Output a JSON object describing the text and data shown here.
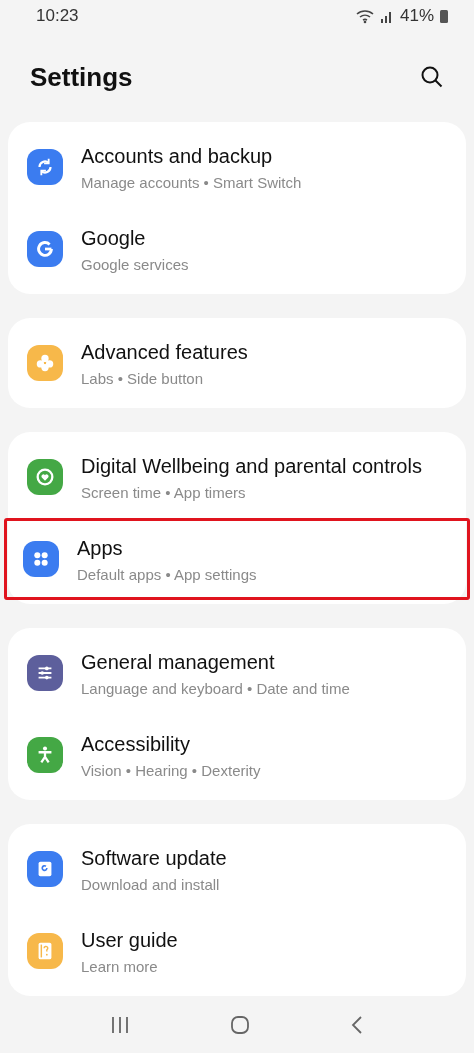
{
  "status_bar": {
    "time": "10:23",
    "battery": "41%"
  },
  "header": {
    "title": "Settings"
  },
  "groups": [
    {
      "items": [
        {
          "kind": "sync",
          "color": "#3b7cf0",
          "title": "Accounts and backup",
          "subtitle": "Manage accounts • Smart Switch",
          "highlighted": false
        },
        {
          "kind": "google",
          "color": "#3b7cf0",
          "title": "Google",
          "subtitle": "Google services",
          "highlighted": false
        }
      ]
    },
    {
      "items": [
        {
          "kind": "flower",
          "color": "#f7b84a",
          "title": "Advanced features",
          "subtitle": "Labs • Side button",
          "highlighted": false
        }
      ]
    },
    {
      "items": [
        {
          "kind": "heart",
          "color": "#44a845",
          "title": "Digital Wellbeing and parental controls",
          "subtitle": "Screen time • App timers",
          "highlighted": false
        },
        {
          "kind": "dots",
          "color": "#3b7cf0",
          "title": "Apps",
          "subtitle": "Default apps • App settings",
          "highlighted": true
        }
      ]
    },
    {
      "items": [
        {
          "kind": "sliders",
          "color": "#5d5f9c",
          "title": "General management",
          "subtitle": "Language and keyboard • Date and time",
          "highlighted": false
        },
        {
          "kind": "person",
          "color": "#44a845",
          "title": "Accessibility",
          "subtitle": "Vision • Hearing • Dexterity",
          "highlighted": false
        }
      ]
    },
    {
      "items": [
        {
          "kind": "update",
          "color": "#3b7cf0",
          "title": "Software update",
          "subtitle": "Download and install",
          "highlighted": false
        },
        {
          "kind": "guide",
          "color": "#f7b84a",
          "title": "User guide",
          "subtitle": "Learn more",
          "highlighted": false
        }
      ]
    }
  ]
}
